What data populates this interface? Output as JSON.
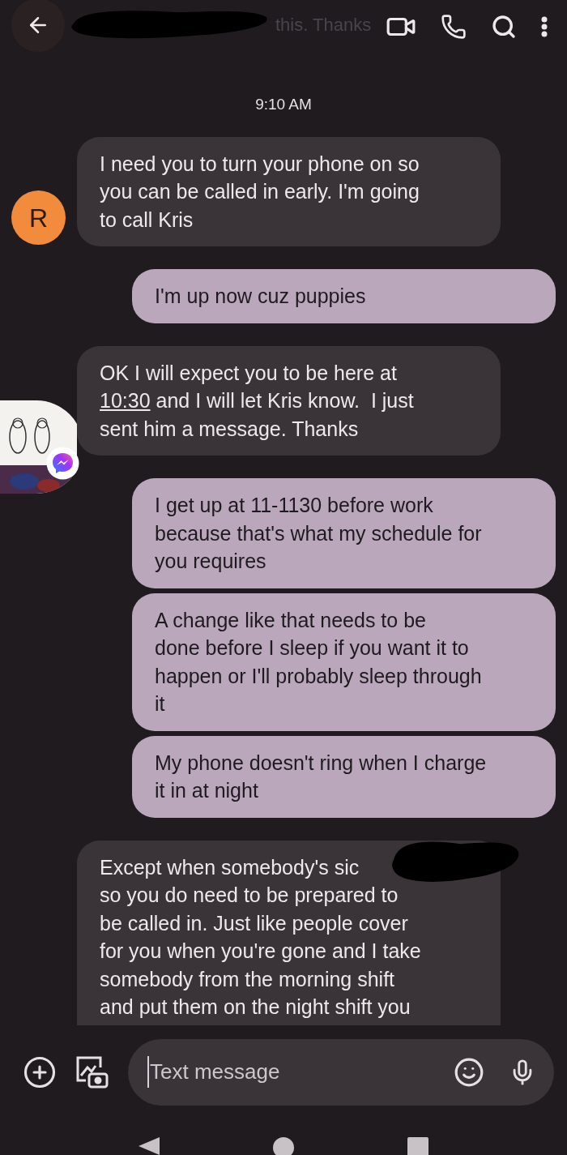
{
  "header": {
    "subtitle": "this. Thanks"
  },
  "timestamp": "9:10 AM",
  "messages": [
    {
      "kind": "incoming",
      "avatar": {
        "kind": "letter",
        "letter": "R",
        "color": "#f28b3b"
      },
      "parts": [
        {
          "text": "I need you to turn your phone on so\nyou can be called in early. I'm going\nto call Kris"
        }
      ]
    },
    {
      "kind": "outgoing",
      "parts": [
        {
          "text": "I'm up now cuz puppies"
        }
      ]
    },
    {
      "kind": "incoming",
      "avatar": {
        "kind": "picture",
        "badge": true
      },
      "parts": [
        {
          "text": "OK I will expect you to be here at\n"
        },
        {
          "text": "10:30",
          "link": true
        },
        {
          "text": " and I will let Kris know.  I just\nsent him a message. Thanks"
        }
      ]
    },
    {
      "kind": "outgoing",
      "parts": [
        {
          "text": "I get up at 11-1130 before work\nbecause that's what my schedule for\nyou requires"
        }
      ]
    },
    {
      "kind": "outgoing",
      "parts": [
        {
          "text": "A change like that needs to be\ndone before I sleep if you want it to\nhappen or I'll probably sleep through\nit"
        }
      ]
    },
    {
      "kind": "outgoing",
      "parts": [
        {
          "text": "My phone doesn't ring when I charge\nit in at night"
        }
      ]
    },
    {
      "kind": "incoming",
      "redacted": true,
      "cut": true,
      "parts": [
        {
          "text": "Except when somebody's sic\nso you do need to be prepared to\nbe called in. Just like people cover\nfor you when you're gone and I take\nsomebody from the morning shift\nand put them on the night shift you"
        }
      ]
    }
  ],
  "composer": {
    "placeholder": "Text message"
  }
}
